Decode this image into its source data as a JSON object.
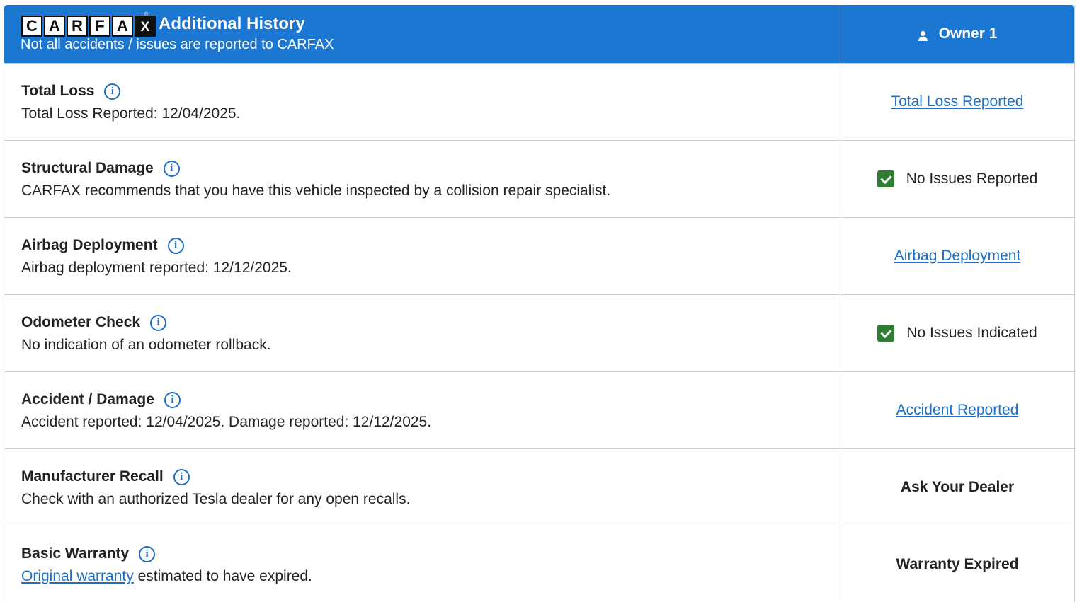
{
  "header": {
    "logo_letters": [
      "C",
      "A",
      "R",
      "F",
      "A",
      "X"
    ],
    "title": "Additional History",
    "subtitle": "Not all accidents / issues are reported to CARFAX",
    "owner_label": "Owner 1"
  },
  "rows": [
    {
      "title": "Total Loss",
      "description": "Total Loss Reported: 12/04/2025.",
      "status": "Total Loss Reported",
      "status_type": "link"
    },
    {
      "title": "Structural Damage",
      "description": "CARFAX recommends that you have this vehicle inspected by a collision repair specialist.",
      "status": "No Issues Reported",
      "status_type": "check"
    },
    {
      "title": "Airbag Deployment",
      "description": "Airbag deployment reported: 12/12/2025.",
      "status": "Airbag Deployment",
      "status_type": "link"
    },
    {
      "title": "Odometer Check",
      "description": "No indication of an odometer rollback.",
      "status": "No Issues Indicated",
      "status_type": "check"
    },
    {
      "title": "Accident / Damage",
      "description": "Accident reported: 12/04/2025. Damage reported: 12/12/2025.",
      "status": "Accident Reported",
      "status_type": "link"
    },
    {
      "title": "Manufacturer Recall",
      "description": "Check with an authorized Tesla dealer for any open recalls.",
      "status": "Ask Your Dealer",
      "status_type": "bold"
    },
    {
      "title": "Basic Warranty",
      "description_link": "Original warranty",
      "description": " estimated to have expired.",
      "status": "Warranty Expired",
      "status_type": "bold"
    }
  ],
  "colors": {
    "header_bg": "#1c77d2",
    "link": "#1c6fc7",
    "check": "#2e7d32",
    "border": "#c9ced4"
  }
}
